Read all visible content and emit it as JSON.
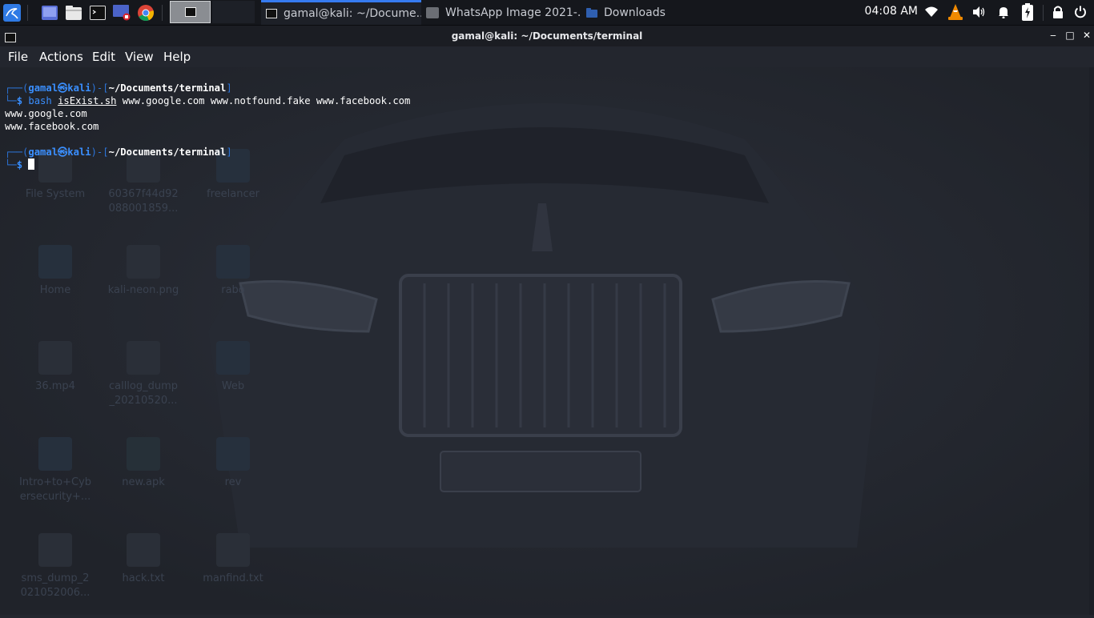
{
  "panel": {
    "launchers": [
      "kali-menu-icon",
      "desktop-icon",
      "file-manager-icon",
      "terminal-icon",
      "screen-recorder-icon",
      "chrome-icon"
    ],
    "tasks": [
      {
        "label": "gamal@kali: ~/Docume...",
        "icon": "terminal-icon",
        "active": true
      },
      {
        "label": "WhatsApp Image 2021-...",
        "icon": "image-icon",
        "active": false
      },
      {
        "label": "Downloads",
        "icon": "folder-icon",
        "active": false
      }
    ],
    "clock": "04:08 AM",
    "tray": [
      "wifi-icon",
      "vlc-icon",
      "volume-icon",
      "notification-icon",
      "battery-icon",
      "lock-icon",
      "power-icon"
    ]
  },
  "window": {
    "title": "gamal@kali: ~/Documents/terminal",
    "buttons": {
      "minimize": "‒",
      "maximize": "□",
      "close": "✕"
    }
  },
  "menubar": [
    "File",
    "Actions",
    "Edit",
    "View",
    "Help"
  ],
  "terminal": {
    "user": "gamal",
    "at": "㉿",
    "host": "kali",
    "path": "~/Documents/terminal",
    "command_prog": "bash",
    "command_script": "isExist.sh",
    "command_args": "www.google.com www.notfound.fake www.facebook.com",
    "output": [
      "www.google.com",
      "www.facebook.com"
    ],
    "prompt_symbol": "$"
  },
  "desktop_icons": [
    {
      "label": "File System"
    },
    {
      "label": "60367f44d92 088001859..."
    },
    {
      "label": "freelancer"
    },
    {
      "label": "Home"
    },
    {
      "label": "kali-neon.png"
    },
    {
      "label": "rabo"
    },
    {
      "label": "36.mp4"
    },
    {
      "label": "calllog_dump _20210520..."
    },
    {
      "label": "Web"
    },
    {
      "label": "Intro+to+Cyb ersecurity+..."
    },
    {
      "label": "new.apk"
    },
    {
      "label": "rev"
    },
    {
      "label": "sms_dump_2 021052006..."
    },
    {
      "label": "hack.txt"
    },
    {
      "label": "manfind.txt"
    }
  ],
  "colors": {
    "accent": "#367bf0",
    "prompt_blue": "#3a8fff",
    "background": "#23262e"
  }
}
